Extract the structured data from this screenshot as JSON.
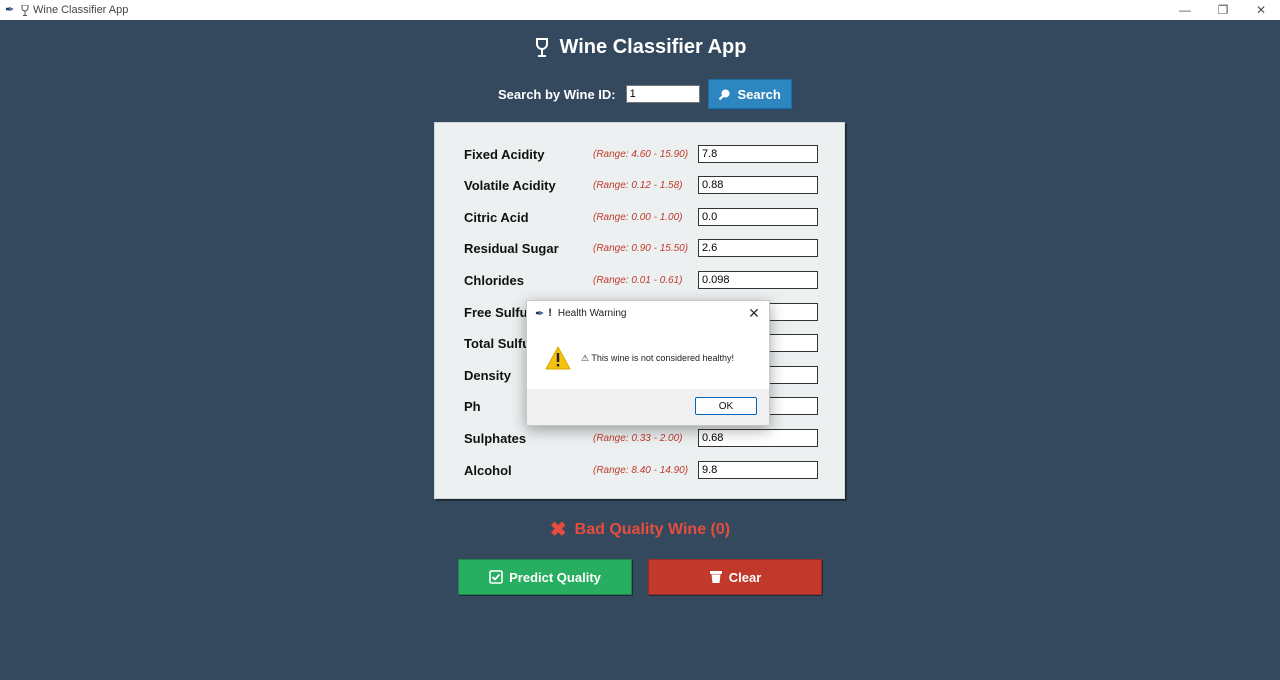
{
  "window": {
    "title": "Wine Classifier App",
    "title_icon": "wine-glass-icon",
    "controls": {
      "minimize": "—",
      "restore": "❐",
      "close": "✕"
    }
  },
  "header": {
    "title": "Wine Classifier App",
    "icon": "wine-glass-icon"
  },
  "search": {
    "label": "Search by Wine ID:",
    "value": "1",
    "button_label": "Search",
    "button_icon": "magnifier-icon",
    "button_color": "#2e86c1"
  },
  "fields": [
    {
      "label": "Fixed Acidity",
      "range": "(Range: 4.60 - 15.90)",
      "value": "7.8"
    },
    {
      "label": "Volatile Acidity",
      "range": "(Range: 0.12 - 1.58)",
      "value": "0.88"
    },
    {
      "label": "Citric Acid",
      "range": "(Range: 0.00 - 1.00)",
      "value": "0.0"
    },
    {
      "label": "Residual Sugar",
      "range": "(Range: 0.90 - 15.50)",
      "value": "2.6"
    },
    {
      "label": "Chlorides",
      "range": "(Range: 0.01 - 0.61)",
      "value": "0.098"
    },
    {
      "label": "Free Sulfur",
      "range": "",
      "value": ""
    },
    {
      "label": "Total Sulfur",
      "range": "",
      "value": ""
    },
    {
      "label": "Density",
      "range": "",
      "value": ""
    },
    {
      "label": "Ph",
      "range": "",
      "value": ""
    },
    {
      "label": "Sulphates",
      "range": "(Range: 0.33 - 2.00)",
      "value": "0.68"
    },
    {
      "label": "Alcohol",
      "range": "(Range: 8.40 - 14.90)",
      "value": "9.8"
    }
  ],
  "result": {
    "text": "Bad Quality Wine (0)",
    "icon": "x-icon",
    "color": "#e74c3c"
  },
  "buttons": {
    "predict": {
      "label": "Predict Quality",
      "icon": "checkbox-icon",
      "color": "#27ae60"
    },
    "clear": {
      "label": "Clear",
      "icon": "trash-icon",
      "color": "#c0392b"
    }
  },
  "dialog": {
    "title": "Health Warning",
    "title_prefix": "!",
    "message": "⚠ This wine is not considered healthy!",
    "icon": "warning-icon",
    "ok_label": "OK"
  }
}
